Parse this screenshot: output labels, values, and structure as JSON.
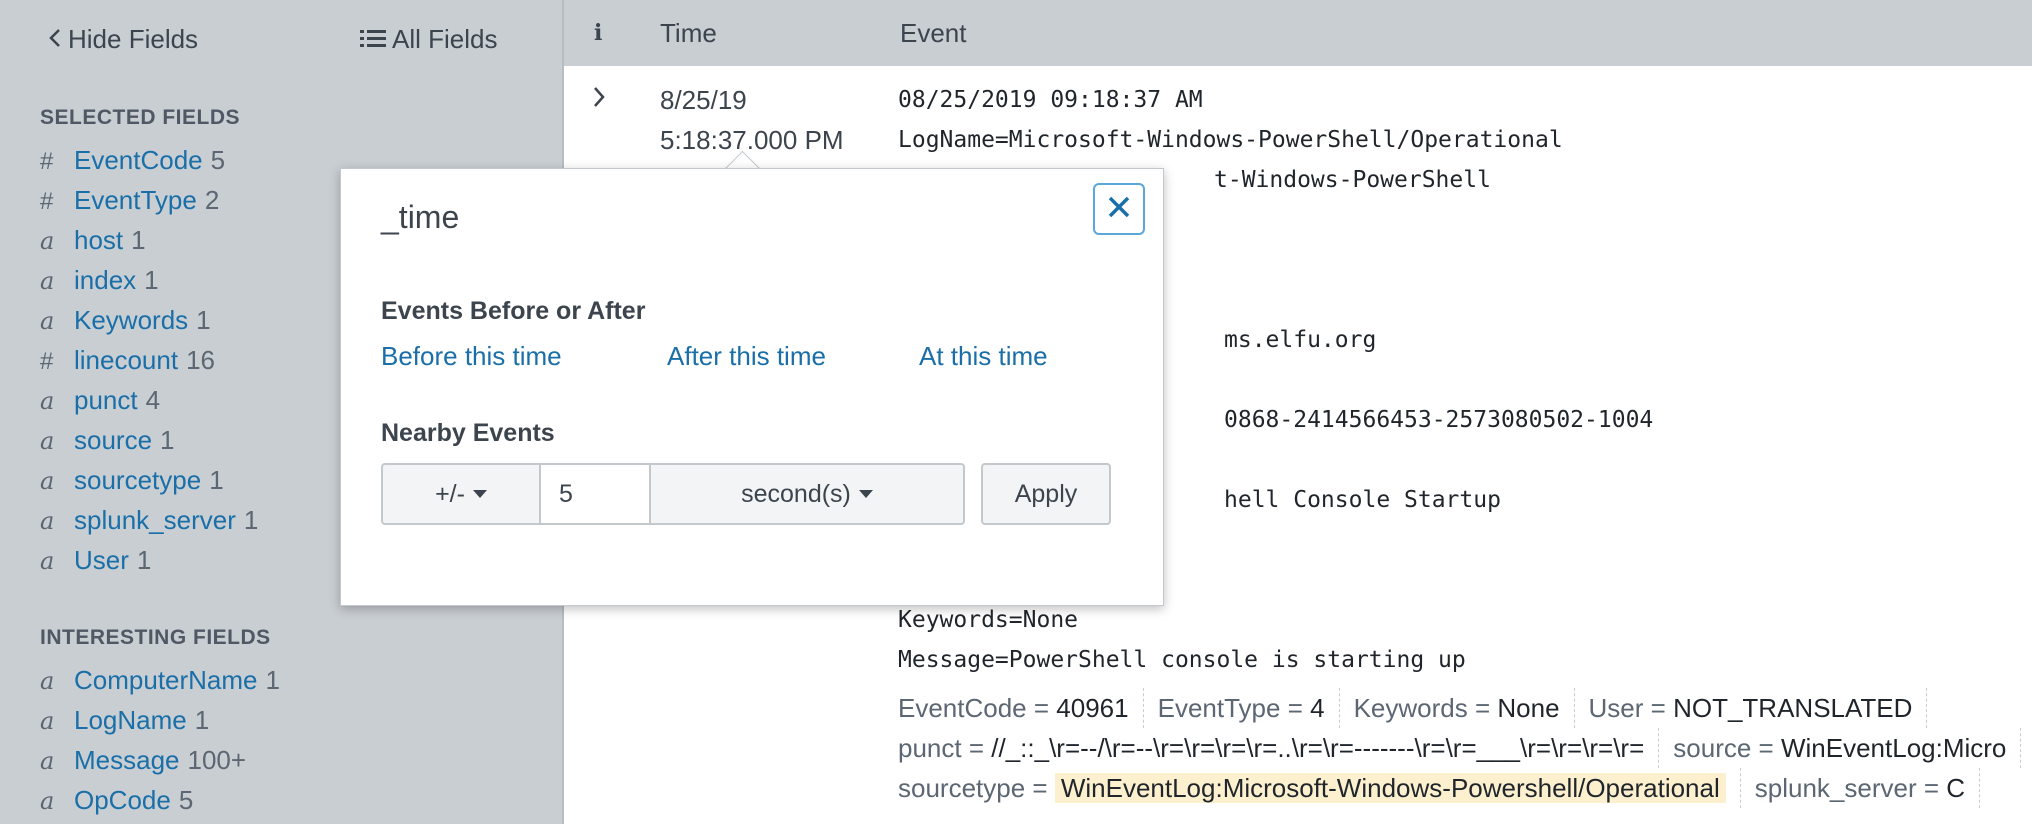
{
  "sidebar": {
    "hide_fields": "Hide Fields",
    "all_fields": "All Fields",
    "selected_heading": "SELECTED FIELDS",
    "selected": [
      {
        "type": "#",
        "name": "EventCode",
        "count": "5"
      },
      {
        "type": "#",
        "name": "EventType",
        "count": "2"
      },
      {
        "type": "a",
        "name": "host",
        "count": "1"
      },
      {
        "type": "a",
        "name": "index",
        "count": "1"
      },
      {
        "type": "a",
        "name": "Keywords",
        "count": "1"
      },
      {
        "type": "#",
        "name": "linecount",
        "count": "16"
      },
      {
        "type": "a",
        "name": "punct",
        "count": "4"
      },
      {
        "type": "a",
        "name": "source",
        "count": "1"
      },
      {
        "type": "a",
        "name": "sourcetype",
        "count": "1"
      },
      {
        "type": "a",
        "name": "splunk_server",
        "count": "1"
      },
      {
        "type": "a",
        "name": "User",
        "count": "1"
      }
    ],
    "interesting_heading": "INTERESTING FIELDS",
    "interesting": [
      {
        "type": "a",
        "name": "ComputerName",
        "count": "1"
      },
      {
        "type": "a",
        "name": "LogName",
        "count": "1"
      },
      {
        "type": "a",
        "name": "Message",
        "count": "100+"
      },
      {
        "type": "a",
        "name": "OpCode",
        "count": "5"
      }
    ]
  },
  "table": {
    "col_info": "i",
    "col_time": "Time",
    "col_event": "Event"
  },
  "event": {
    "time_date": "8/25/19",
    "time_clock": "5:18:37.000 PM",
    "lines": [
      "08/25/2019 09:18:37 AM",
      "LogName=Microsoft-Windows-PowerShell/Operational",
      "t-Windows-PowerShell",
      "ms.elfu.org",
      "0868-2414566453-2573080502-1004",
      "hell Console Startup",
      "Keywords=None",
      "Message=PowerShell console is starting up"
    ],
    "fields_row1": [
      {
        "k": "EventCode",
        "v": "40961"
      },
      {
        "k": "EventType",
        "v": "4"
      },
      {
        "k": "Keywords",
        "v": "None"
      },
      {
        "k": "User",
        "v": "NOT_TRANSLATED"
      }
    ],
    "fields_row2": [
      {
        "k": "punct",
        "v": "//_::_\\r=--/\\r=--\\r=\\r=\\r=\\r=..\\r=\\r=-------\\r=\\r=___\\r=\\r=\\r=\\r="
      },
      {
        "k": "source",
        "v": "WinEventLog:Micro"
      }
    ],
    "fields_row3": [
      {
        "k": "sourcetype",
        "v": "WinEventLog:Microsoft-Windows-Powershell/Operational"
      },
      {
        "k": "splunk_server",
        "v": "C"
      }
    ]
  },
  "popup": {
    "title": "_time",
    "section_before_after": "Events Before or After",
    "link_before": "Before this time",
    "link_after": "After this time",
    "link_at": "At this time",
    "section_nearby": "Nearby Events",
    "sign_option": "+/-",
    "amount_value": "5",
    "unit_option": "second(s)",
    "apply_label": "Apply"
  },
  "colors": {
    "link": "#1a6fa8",
    "sidebar_bg": "#c9ced3",
    "highlight": "#fdf0cf"
  }
}
